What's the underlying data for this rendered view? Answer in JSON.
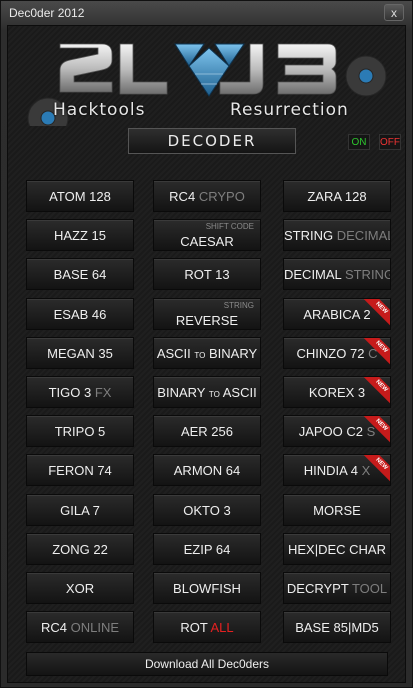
{
  "window": {
    "title": "Dec0der 2012",
    "close_label": "x"
  },
  "header": {
    "logo_text": "2L J3",
    "subtitle_left": "Hacktools",
    "subtitle_right": "Resurrection",
    "mode_label": "DECODER",
    "on_label": "ON",
    "off_label": "OFF"
  },
  "colors": {
    "accent_blue": "#3a8fc7",
    "new_ribbon": "#c61b1b",
    "on_green": "#2ec52e",
    "off_red": "#e33333"
  },
  "buttons": [
    {
      "main": "ATOM 128"
    },
    {
      "main": "RC4",
      "extra": "CRYPO"
    },
    {
      "main": "ZARA 128"
    },
    {
      "main": "HAZZ 15"
    },
    {
      "main": "CAESAR",
      "sup": "SHIFT CODE"
    },
    {
      "main": "STRING",
      "extra": "DECIMAL"
    },
    {
      "main": "BASE 64"
    },
    {
      "main": "ROT 13"
    },
    {
      "main": "DECIMAL",
      "extra": "STRING"
    },
    {
      "main": "ESAB 46"
    },
    {
      "main": "REVERSE",
      "sup": "STRING"
    },
    {
      "main": "ARABICA 2",
      "badge": "NEW"
    },
    {
      "main": "MEGAN 35"
    },
    {
      "main": "ASCII",
      "small": "TO",
      "tail": "BINARY"
    },
    {
      "main": "CHINZO 72",
      "extra": "C",
      "badge": "NEW"
    },
    {
      "main": "TIGO 3",
      "extra": "FX"
    },
    {
      "main": "BINARY",
      "small": "TO",
      "tail": "ASCII"
    },
    {
      "main": "KOREX 3",
      "badge": "NEW"
    },
    {
      "main": "TRIPO 5"
    },
    {
      "main": "AER 256"
    },
    {
      "main": "JAPOO C2",
      "extra": "S",
      "badge": "NEW"
    },
    {
      "main": "FERON 74"
    },
    {
      "main": "ARMON 64"
    },
    {
      "main": "HINDIA 4",
      "extra": "X",
      "badge": "NEW"
    },
    {
      "main": "GILA 7"
    },
    {
      "main": "OKTO 3"
    },
    {
      "main": "MORSE"
    },
    {
      "main": "ZONG 22"
    },
    {
      "main": "EZIP 64"
    },
    {
      "main": "HEX|DEC CHAR"
    },
    {
      "main": "XOR"
    },
    {
      "main": "BLOWFISH"
    },
    {
      "main": "DECRYPT",
      "extra": "TOOL"
    },
    {
      "main": "RC4",
      "extra": "ONLINE"
    },
    {
      "main": "ROT",
      "red": "ALL"
    },
    {
      "main": "BASE 85|MD5"
    }
  ],
  "footer": {
    "download_label": "Download All Dec0ders"
  }
}
